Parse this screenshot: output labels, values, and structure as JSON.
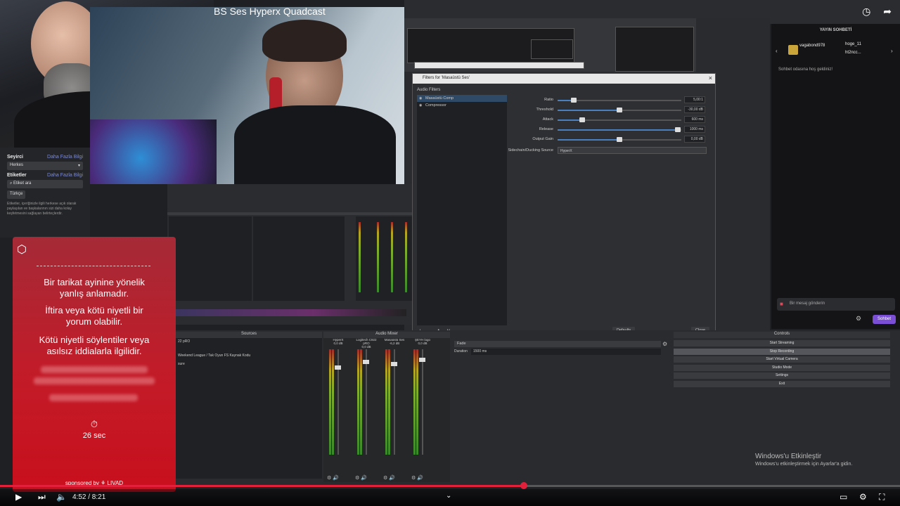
{
  "video": {
    "title": "BS Ses Hyperx Quadcast",
    "time": "4:52 / 8:21",
    "progress": 0.582
  },
  "left_panel": {
    "audience_label": "Seyirci",
    "audience_more": "Daha Fazla Bilgi",
    "audience_value": "Herkes",
    "tags_label": "Etiketler",
    "tags_more": "Daha Fazla Bilgi",
    "tags_placeholder": "Etiket ara",
    "tag_chip": "Türkçe",
    "desc": "Etiketler, içeriğinizle ilgili herkese açık olarak paylaşılan ve başkalarının sizi daha kolay keşfetmesini sağlayan belirteçlerdir."
  },
  "filters_dialog": {
    "title": "Filters for 'Masaüstü Ses'",
    "close": "×",
    "audio_filters_label": "Audio Filters",
    "filters": [
      {
        "name": "Masaüstü Comp",
        "selected": true
      },
      {
        "name": "Compressor",
        "selected": false
      }
    ],
    "params": [
      {
        "name": "Ratio",
        "value": "5,00:1",
        "level": 0.13
      },
      {
        "name": "Threshold",
        "value": "-30,00 dB",
        "level": 0.5
      },
      {
        "name": "Attack",
        "value": "600 ms",
        "level": 0.2
      },
      {
        "name": "Release",
        "value": "1000 ms",
        "level": 0.97
      },
      {
        "name": "Output Gain",
        "value": "0,00 dB",
        "level": 0.5
      }
    ],
    "sidechain_label": "Sidechain/Ducking Source",
    "sidechain_value": "HyperX",
    "defaults_button": "Defaults",
    "close_button": "Close",
    "bottom_controls": "+ − ∧ ∨"
  },
  "obs": {
    "sources_header": "Sources",
    "mixer_header": "Audio Mixer",
    "sources": [
      "22 pRO",
      "Weekend League / Tak Oyun FS Kaynak Kodu",
      "sure"
    ],
    "mixer_channels": [
      {
        "name": "HyperX",
        "db": "0,0 dB",
        "fader": 0.15
      },
      {
        "name": "Logitech C922 pRO",
        "db": "0,0 dB",
        "fader": 0.1
      },
      {
        "name": "Masaüstü Ses",
        "db": "-6,2 dB",
        "fader": 0.12
      },
      {
        "name": "ŞEYH logo",
        "db": "0,0 dB",
        "fader": 0.08
      }
    ],
    "props_fade_label": "Fade",
    "props_duration_label": "Duration",
    "props_duration_value": "1500 ms",
    "controls_header": "Controls",
    "controls": [
      "Start Streaming",
      "Stop Recording",
      "Start Virtual Camera",
      "Studio Mode",
      "Settings",
      "Exit"
    ]
  },
  "chat": {
    "title": "YAYIN SOHBETİ",
    "user1": "vagabond978",
    "user2a": "hoge_11",
    "user2b": "ht2ncc...",
    "welcome": "Sohbet odasına hoş geldiniz!",
    "input_placeholder": "Bir mesaj gönderin",
    "send_button": "Sohbet"
  },
  "ad": {
    "line1": "Bir tarikat ayinine yönelik yanlış anlamadır.",
    "line2": "İftira veya kötü niyetli bir yorum olabilir.",
    "line3": "Kötü niyetli söylentiler veya asılsız iddialarla ilgilidir.",
    "timer": "26 sec",
    "sponsor": "sponsored by ⚘ LIVAD"
  },
  "windows": {
    "activate_title": "Windows'u Etkinleştir",
    "activate_sub": "Windows'u etkinleştirmek için Ayarlar'a gidin."
  }
}
